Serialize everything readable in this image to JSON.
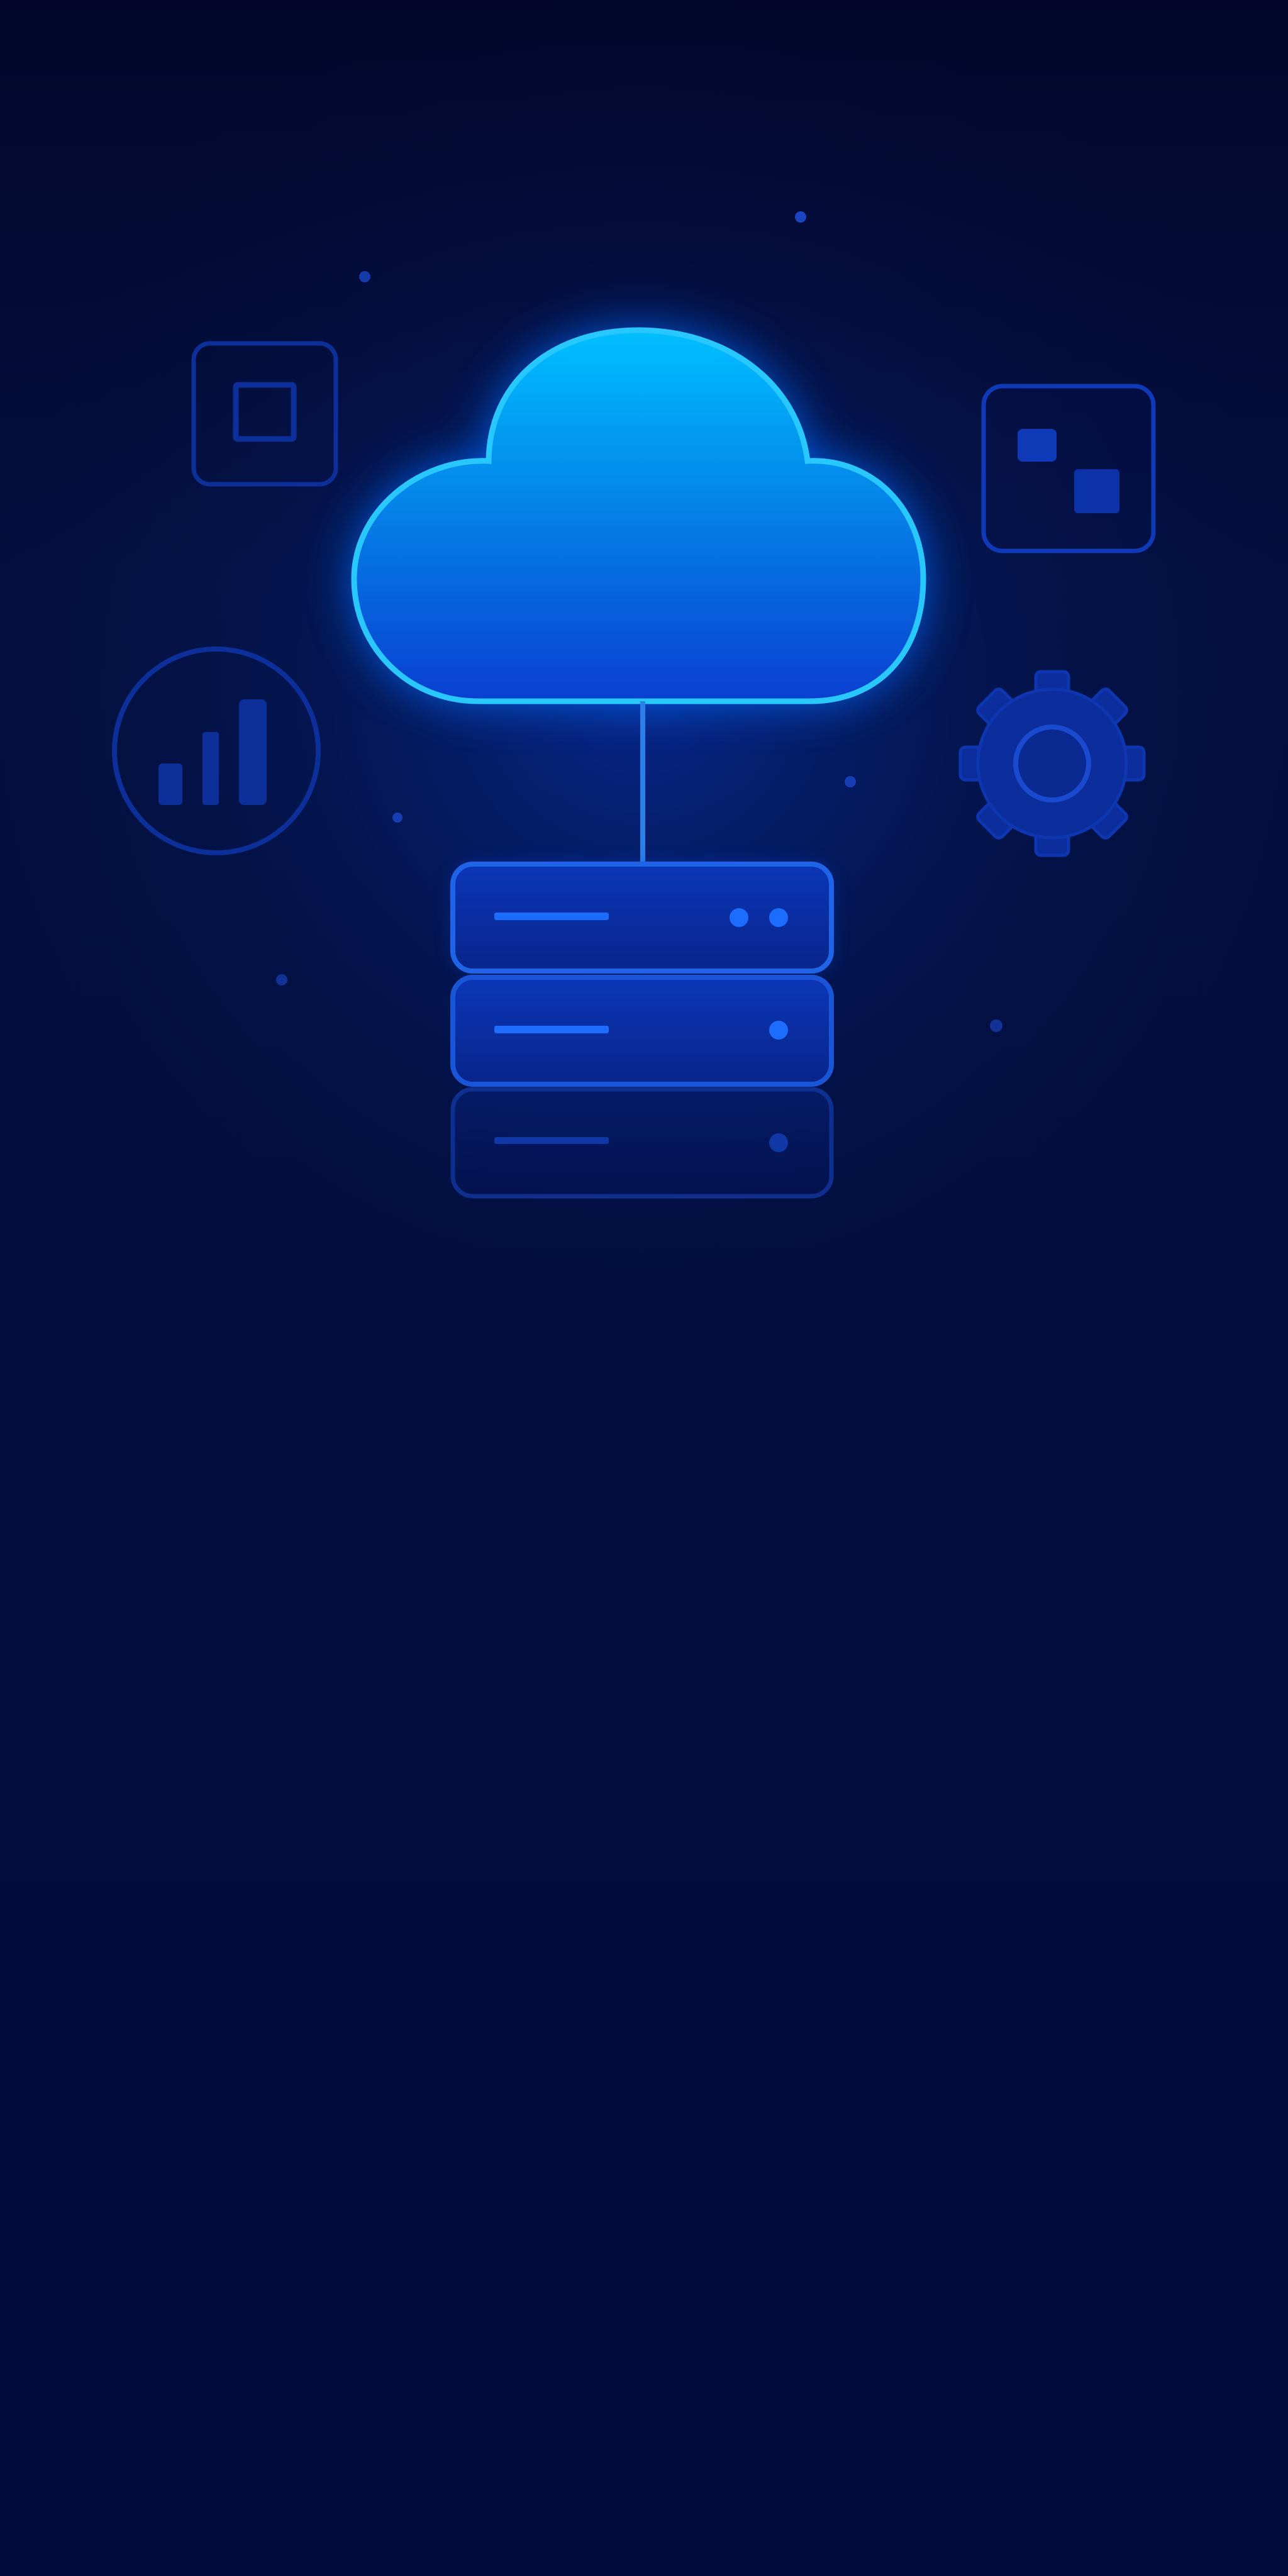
{
  "scene": {
    "background_top": "#03062a",
    "background_bottom": "#010c3d",
    "glow_color": "#0a3ac8",
    "cloud": {
      "fill_top": "#00bfff",
      "fill_bottom": "#0a3fd0",
      "outline": "#28c8ff",
      "icon": "cloud-icon"
    },
    "connector_color": "#2a7fe8",
    "server_stack": {
      "unit_count": 3,
      "unit_fill": "#0a2fa0",
      "unit_outline": "#1f63e6",
      "indicator_color": "#1c6cff",
      "icon": "server-icon"
    },
    "floating_icons": [
      {
        "name": "chip-icon",
        "color": "#0c2f9a"
      },
      {
        "name": "bar-chart-icon",
        "color": "#0c2f9a"
      },
      {
        "name": "window-tiles-icon",
        "color": "#0e3ab8"
      },
      {
        "name": "gear-icon",
        "color": "#0d36b0"
      }
    ],
    "particle_color": "#1f4fd8"
  }
}
